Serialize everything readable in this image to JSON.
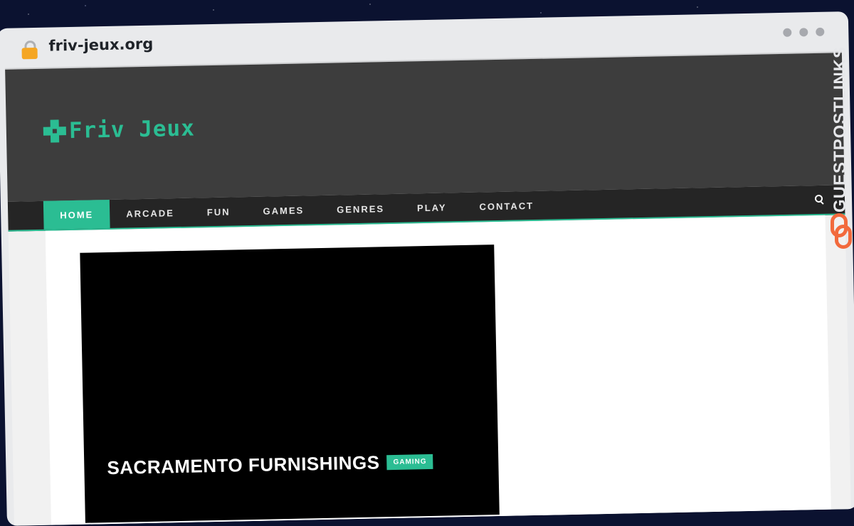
{
  "browser": {
    "url": "friv-jeux.org"
  },
  "site": {
    "logo_text": "Friv Jeux"
  },
  "nav": {
    "items": [
      {
        "label": "HOME",
        "active": true
      },
      {
        "label": "ARCADE",
        "active": false
      },
      {
        "label": "FUN",
        "active": false
      },
      {
        "label": "GAMES",
        "active": false
      },
      {
        "label": "GENRES",
        "active": false
      },
      {
        "label": "PLAY",
        "active": false
      },
      {
        "label": "CONTACT",
        "active": false
      }
    ]
  },
  "hero": {
    "title": "SACRAMENTO FURNISHINGS",
    "category_badge": "GAMING"
  },
  "watermark": {
    "text": "GUESTPOSTLINKS"
  },
  "colors": {
    "accent": "#2bbd93",
    "header_bg": "#3d3d3d",
    "nav_bg": "#252525",
    "lock": "#f5a623",
    "watermark_icon": "#f26a3d"
  },
  "icons": {
    "address_bar": "lock-icon",
    "nav_search": "search-icon",
    "logo": "gamepad-cross-icon",
    "watermark": "chain-link-icon"
  }
}
